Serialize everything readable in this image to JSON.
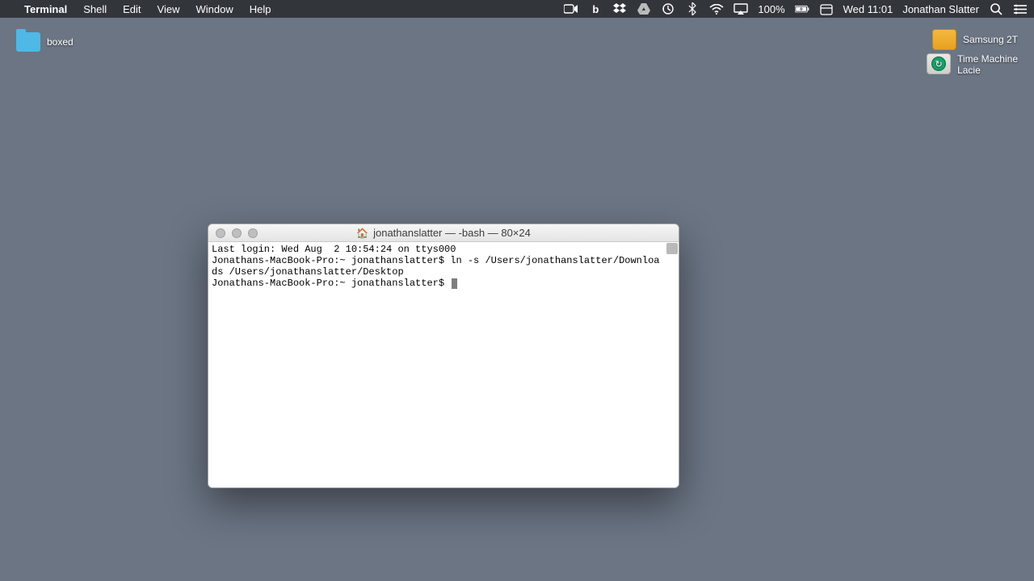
{
  "menubar": {
    "app": "Terminal",
    "items": [
      "Shell",
      "Edit",
      "View",
      "Window",
      "Help"
    ],
    "battery": "100%",
    "clock": "Wed 11:01",
    "user": "Jonathan Slatter"
  },
  "desktop": {
    "boxed_label": "boxed",
    "drive1_label": "Samsung 2T",
    "drive2_label_line1": "Time Machine",
    "drive2_label_line2": "Lacie"
  },
  "terminal": {
    "title": "jonathanslatter — -bash — 80×24",
    "line1": "Last login: Wed Aug  2 10:54:24 on ttys000",
    "line2": "Jonathans-MacBook-Pro:~ jonathanslatter$ ln -s /Users/jonathanslatter/Downloads /Users/jonathanslatter/Desktop",
    "line3": "Jonathans-MacBook-Pro:~ jonathanslatter$ "
  }
}
